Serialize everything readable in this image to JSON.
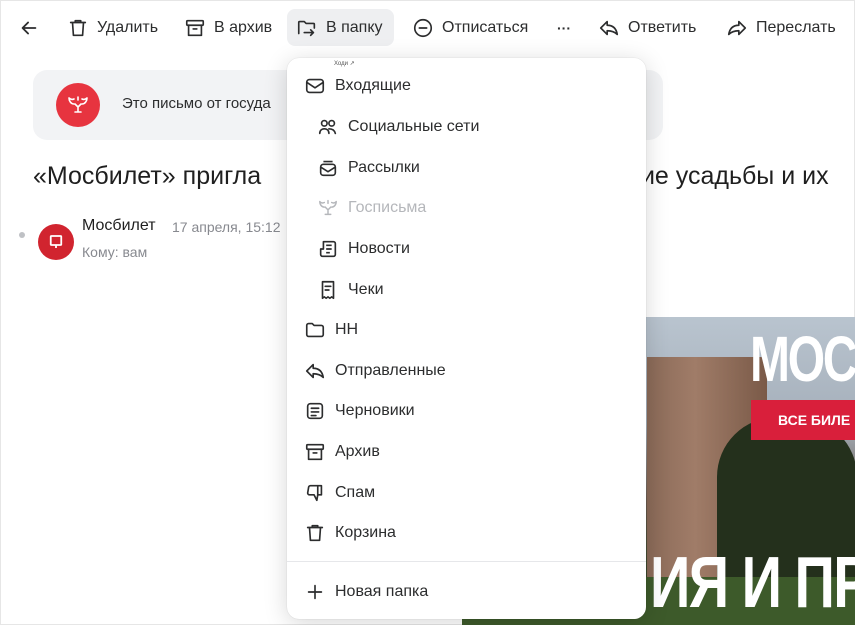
{
  "toolbar": {
    "back_label": "",
    "delete_label": "Удалить",
    "archive_label": "В архив",
    "move_label": "В папку",
    "unsubscribe_label": "Отписаться",
    "more_label": "···",
    "reply_label": "Ответить",
    "forward_label": "Переслать"
  },
  "banner": {
    "text": "Это письмо от госуда"
  },
  "email": {
    "subject_left": "«Мосбилет» пригла",
    "subject_right": "кие усадьбы и их",
    "sender": "Мосбилет",
    "date": "17 апреля, 15:12",
    "to": "Кому: вам"
  },
  "promo": {
    "brand": "МОС:",
    "cta": "ВСЕ БИЛЕ",
    "big_text": "ИЯ И ПР"
  },
  "folder_menu": {
    "tooltip": "Ходи ↗",
    "items": [
      {
        "label": "Входящие",
        "icon": "inbox-icon"
      },
      {
        "label": "Социальные сети",
        "icon": "people-icon"
      },
      {
        "label": "Рассылки",
        "icon": "newsletter-icon"
      },
      {
        "label": "Госписьма",
        "icon": "emblem-icon",
        "disabled": true
      },
      {
        "label": "Новости",
        "icon": "news-icon"
      },
      {
        "label": "Чеки",
        "icon": "receipt-icon"
      },
      {
        "label": "НН",
        "icon": "folder-icon"
      },
      {
        "label": "Отправленные",
        "icon": "sent-icon"
      },
      {
        "label": "Черновики",
        "icon": "drafts-icon"
      },
      {
        "label": "Архив",
        "icon": "archive-icon"
      },
      {
        "label": "Спам",
        "icon": "spam-icon"
      },
      {
        "label": "Корзина",
        "icon": "trash-icon"
      }
    ],
    "new_folder_label": "Новая папка"
  },
  "colors": {
    "accent_red": "#e7343f",
    "cta_red": "#d91f3b",
    "muted_text": "#87898f",
    "active_bg": "#eeeff1"
  }
}
